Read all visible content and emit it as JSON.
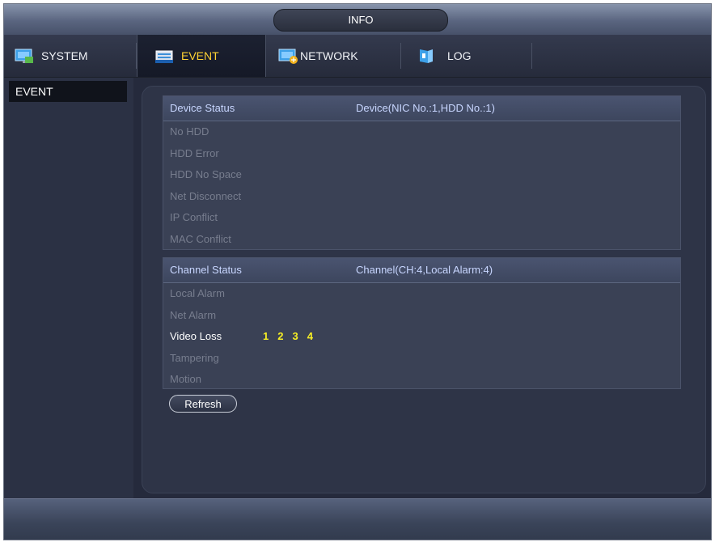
{
  "window": {
    "title": "INFO"
  },
  "tabs": [
    {
      "label": "SYSTEM",
      "icon": "system-icon",
      "active": false
    },
    {
      "label": "EVENT",
      "icon": "event-icon",
      "active": true
    },
    {
      "label": "NETWORK",
      "icon": "network-icon",
      "active": false
    },
    {
      "label": "LOG",
      "icon": "log-icon",
      "active": false
    }
  ],
  "sidebar": {
    "items": [
      {
        "label": "EVENT",
        "selected": true
      }
    ]
  },
  "device_status": {
    "header": "Device Status",
    "summary": "Device(NIC No.:1,HDD No.:1)",
    "items": [
      "No HDD",
      "HDD Error",
      "HDD No Space",
      "Net Disconnect",
      "IP Conflict",
      "MAC Conflict"
    ]
  },
  "channel_status": {
    "header": "Channel Status",
    "summary": "Channel(CH:4,Local Alarm:4)",
    "items": [
      {
        "label": "Local Alarm",
        "active": false,
        "channels": []
      },
      {
        "label": "Net Alarm",
        "active": false,
        "channels": []
      },
      {
        "label": "Video Loss",
        "active": true,
        "channels": [
          "1",
          "2",
          "3",
          "4"
        ]
      },
      {
        "label": "Tampering",
        "active": false,
        "channels": []
      },
      {
        "label": "Motion",
        "active": false,
        "channels": []
      }
    ]
  },
  "buttons": {
    "refresh": "Refresh"
  },
  "colors": {
    "active_tab_text": "#ffd233",
    "channel_highlight": "#f7ef24",
    "header_text": "#c8d6ff",
    "inactive_item_text": "#777d8e"
  }
}
